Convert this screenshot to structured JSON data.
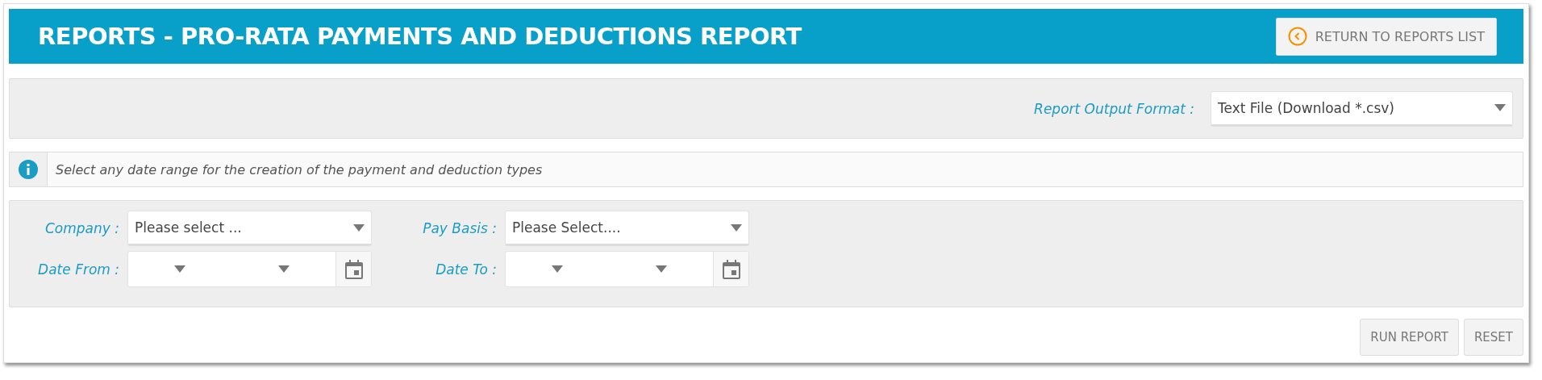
{
  "header": {
    "title": "REPORTS - PRO-RATA PAYMENTS AND DEDUCTIONS REPORT",
    "return_button": "RETURN TO REPORTS LIST"
  },
  "output_format": {
    "label": "Report Output Format :",
    "value": "Text File (Download *.csv)"
  },
  "info": {
    "message": "Select any date range for the creation of the payment and deduction types"
  },
  "fields": [
    {
      "kind": "select",
      "label": "Company :",
      "value": "Please select ..."
    },
    {
      "kind": "select",
      "label": "Pay Basis :",
      "value": "Please Select...."
    },
    {
      "kind": "date",
      "label": "Date From :"
    },
    {
      "kind": "date",
      "label": "Date To :"
    }
  ],
  "buttons": [
    "RUN REPORT",
    "RESET"
  ]
}
